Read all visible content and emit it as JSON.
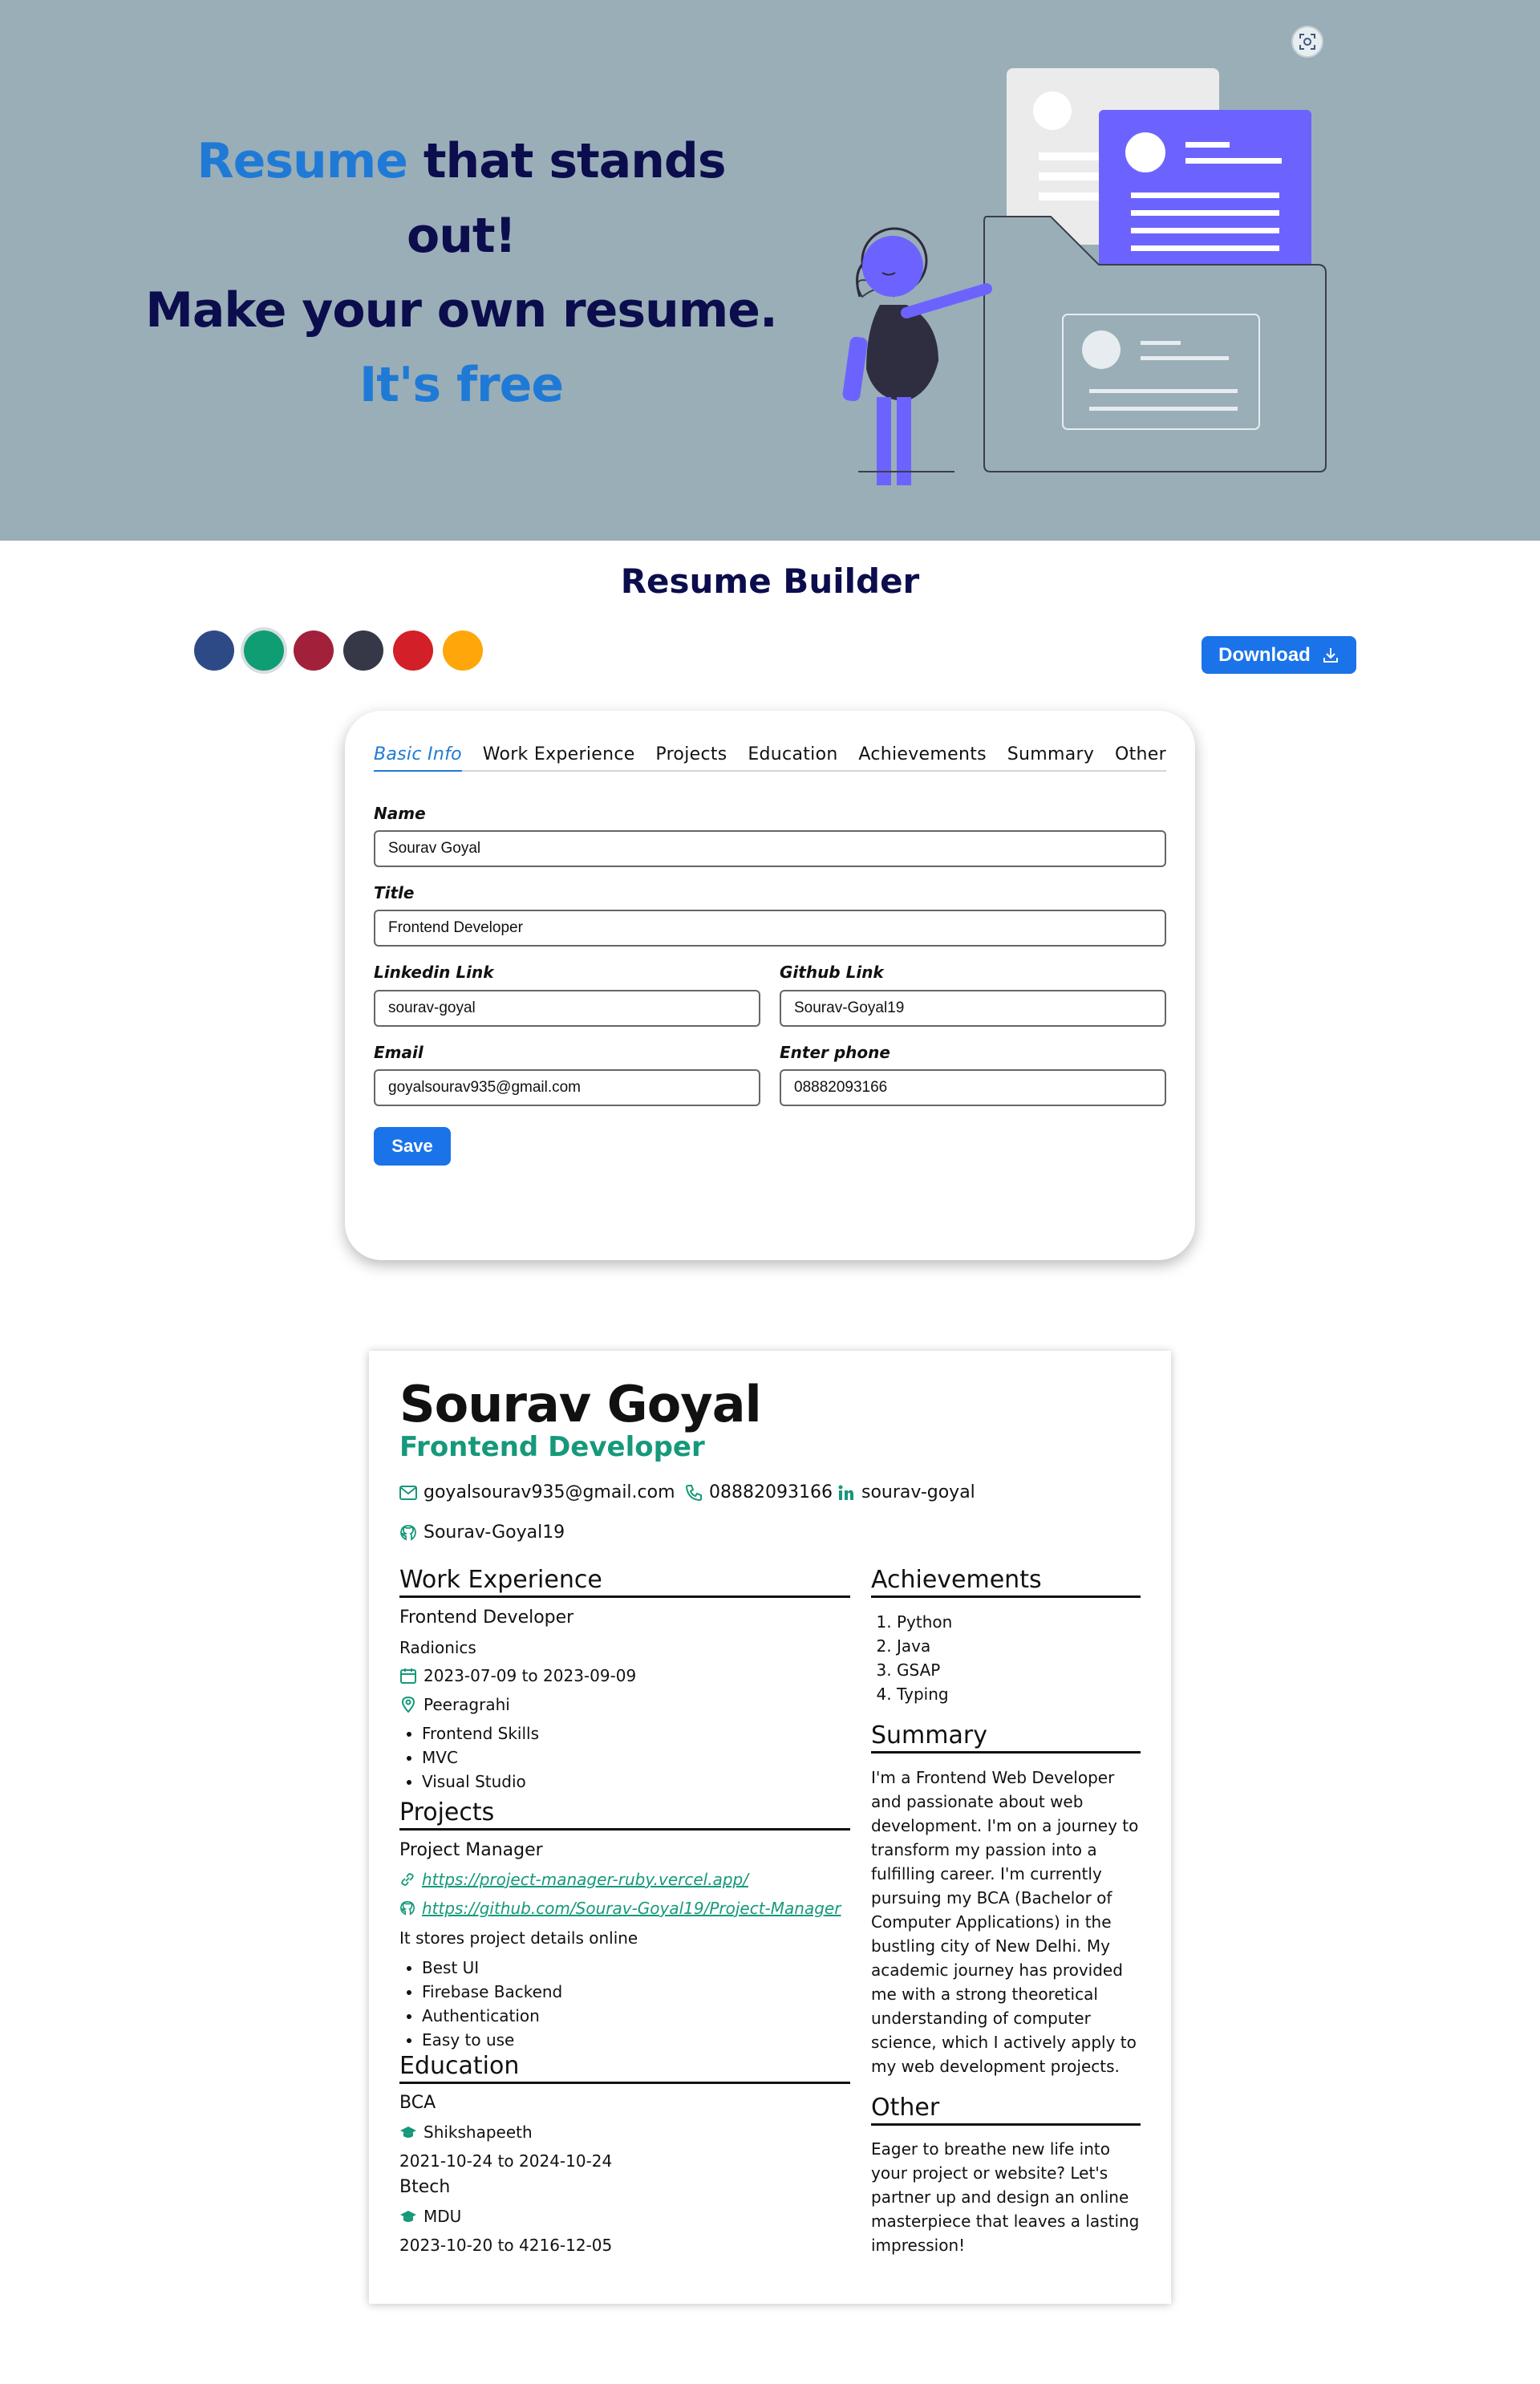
{
  "hero": {
    "line1_accent": "Resume",
    "line1_rest": " that stands",
    "line2": "out!",
    "line3": "Make your own resume.",
    "line4": "It's free"
  },
  "builder": {
    "title": "Resume Builder",
    "download_label": "Download",
    "colors": [
      "#2e4a86",
      "#0f9d74",
      "#a3203a",
      "#363847",
      "#d31f27",
      "#fea60a"
    ],
    "active_color_index": 1
  },
  "editor": {
    "tabs": [
      "Basic Info",
      "Work Experience",
      "Projects",
      "Education",
      "Achievements",
      "Summary",
      "Other"
    ],
    "active_tab": "Basic Info",
    "fields": {
      "name": {
        "label": "Name",
        "value": "Sourav Goyal"
      },
      "title": {
        "label": "Title",
        "value": "Frontend Developer"
      },
      "linkedin": {
        "label": "Linkedin Link",
        "value": "sourav-goyal"
      },
      "github": {
        "label": "Github Link",
        "value": "Sourav-Goyal19"
      },
      "email": {
        "label": "Email",
        "value": "goyalsourav935@gmail.com"
      },
      "phone": {
        "label": "Enter phone",
        "value": "08882093166"
      }
    },
    "save_label": "Save"
  },
  "resume": {
    "name": "Sourav Goyal",
    "title": "Frontend Developer",
    "email": "goyalsourav935@gmail.com",
    "phone": "08882093166",
    "linkedin": "sourav-goyal",
    "github": "Sourav-Goyal19",
    "work": {
      "heading": "Work Experience",
      "role": "Frontend Developer",
      "company": "Radionics",
      "dates": "2023-07-09 to 2023-09-09",
      "location": "Peeragrahi",
      "points": [
        "Frontend Skills",
        "MVC",
        "Visual Studio"
      ]
    },
    "projects": {
      "heading": "Projects",
      "name": "Project Manager",
      "link": "https://project-manager-ruby.vercel.app/",
      "github": "https://github.com/Sourav-Goyal19/Project-Manager",
      "overview": "It stores project details online",
      "points": [
        "Best UI",
        "Firebase Backend",
        "Authentication",
        "Easy to use"
      ]
    },
    "education": {
      "heading": "Education",
      "items": [
        {
          "degree": "BCA",
          "college": "Shikshapeeth",
          "dates": "2021-10-24 to 2024-10-24"
        },
        {
          "degree": "Btech",
          "college": "MDU",
          "dates": "2023-10-20 to 4216-12-05"
        }
      ]
    },
    "achievements": {
      "heading": "Achievements",
      "items": [
        "Python",
        "Java",
        "GSAP",
        "Typing"
      ]
    },
    "summary": {
      "heading": "Summary",
      "lines": [
        "I'm a Frontend Web Developer",
        "and passionate about web",
        "development. I'm on a journey to",
        "transform my passion into a",
        "fulfilling career. I'm currently",
        "pursuing my BCA (Bachelor of",
        "Computer Applications) in the",
        "bustling city of New Delhi. My",
        "academic journey has provided",
        "me with a strong theoretical",
        "understanding of computer",
        "science, which I actively apply to",
        "my web development projects."
      ]
    },
    "other": {
      "heading": "Other",
      "lines": [
        "Eager to breathe new life into",
        "your project or website? Let's",
        "partner up and design an online",
        "masterpiece that leaves a lasting",
        "impression!"
      ]
    }
  }
}
